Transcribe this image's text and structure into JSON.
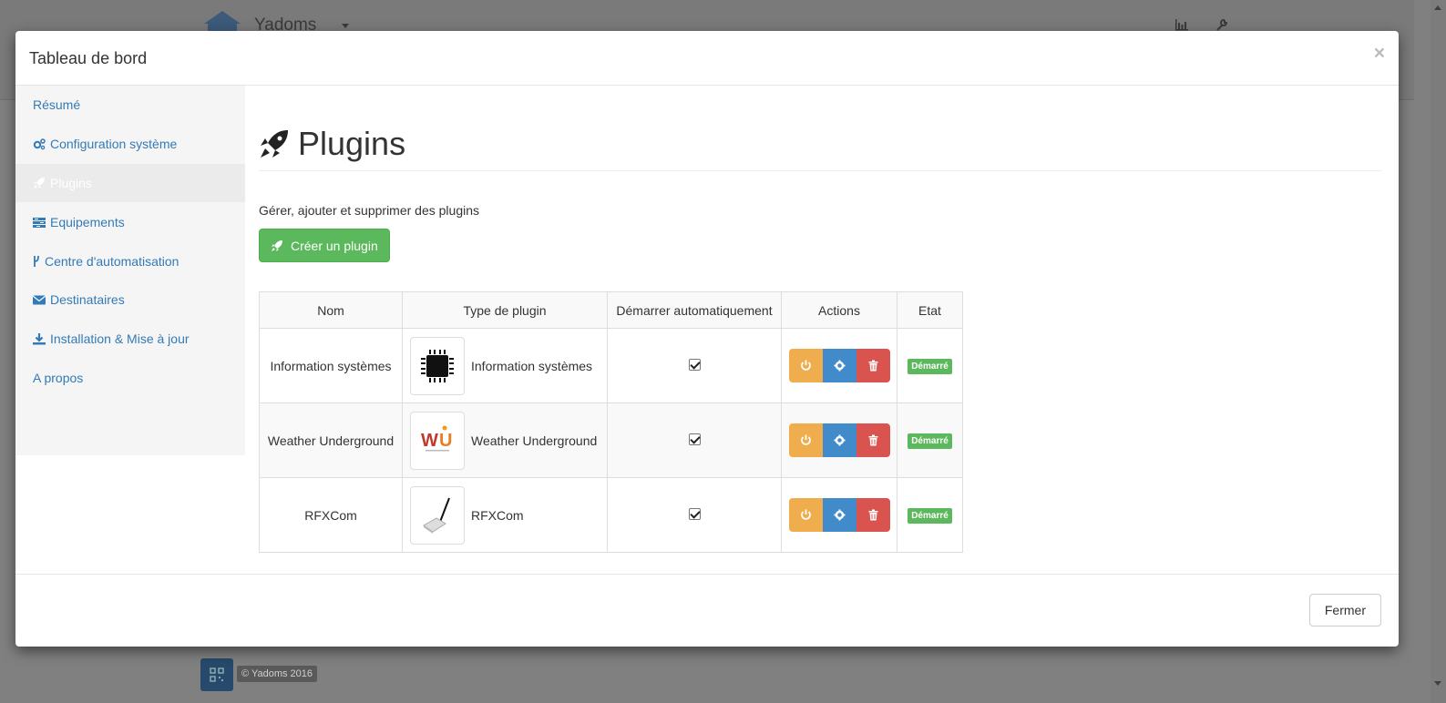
{
  "background": {
    "brand": "Yadoms",
    "footer_text": "© Yadoms 2016"
  },
  "modal": {
    "title": "Tableau de bord",
    "close_symbol": "×",
    "footer_close_label": "Fermer"
  },
  "sidebar": {
    "items": [
      {
        "label": "Résumé",
        "icon": ""
      },
      {
        "label": "Configuration système",
        "icon": "gears-icon"
      },
      {
        "label": "Plugins",
        "icon": "rocket-icon"
      },
      {
        "label": "Equipements",
        "icon": "tasks-icon"
      },
      {
        "label": "Centre d'automatisation",
        "icon": "code-fork-icon"
      },
      {
        "label": "Destinataires",
        "icon": "envelope-icon"
      },
      {
        "label": "Installation & Mise à jour",
        "icon": "download-icon"
      },
      {
        "label": "A propos",
        "icon": ""
      }
    ]
  },
  "main": {
    "title": "Plugins",
    "description": "Gérer, ajouter et supprimer des plugins",
    "create_button": "Créer un plugin"
  },
  "table": {
    "headers": [
      "Nom",
      "Type de plugin",
      "Démarrer automatiquement",
      "Actions",
      "Etat"
    ],
    "rows": [
      {
        "name": "Information systèmes",
        "type": "Information systèmes",
        "thumb": "cpu-icon",
        "autostart": true,
        "state": "Démarré"
      },
      {
        "name": "Weather Underground",
        "type": "Weather Underground",
        "thumb": "wu-logo",
        "autostart": true,
        "state": "Démarré"
      },
      {
        "name": "RFXCom",
        "type": "RFXCom",
        "thumb": "rfxcom-device",
        "autostart": true,
        "state": "Démarré"
      }
    ]
  },
  "colors": {
    "link": "#337ab7",
    "success": "#5cb85c",
    "warning": "#f0ad4e",
    "info": "#428bca",
    "danger": "#d9534f"
  }
}
